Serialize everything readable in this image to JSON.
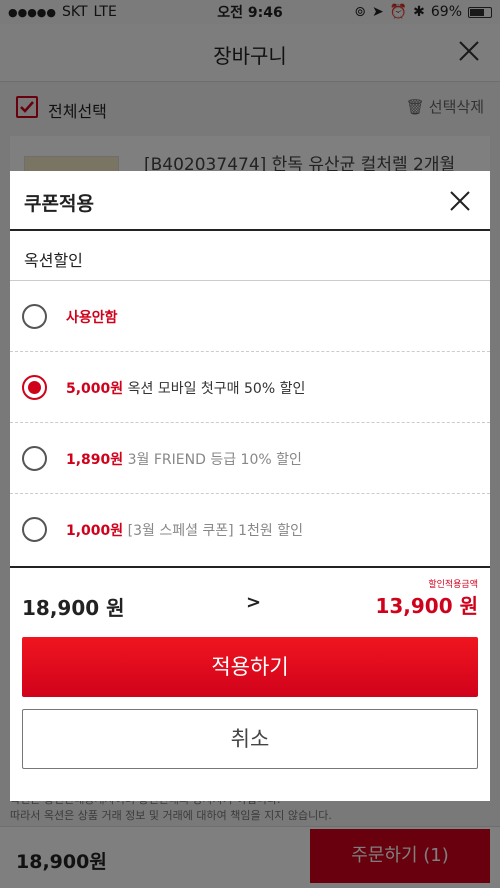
{
  "status_bar": {
    "carrier": "SKT",
    "network": "LTE",
    "time": "오전 9:46",
    "battery": "69%"
  },
  "page": {
    "title": "장바구니",
    "select_all_label": "전체선택",
    "delete_label": "선택삭제",
    "product_title": "[B402037474] 한독 유산균 컬처렐 2개월",
    "notice_lines": [
      "옥션은 통신판매중개자이며 통신판매의 당사자가 아닙니다.",
      "따라서 옥션은 상품 거래 정보 및 거래에 대하여 책임을 지지 않습니다."
    ],
    "total_price": "18,900원",
    "order_button": "주문하기 (1)"
  },
  "modal": {
    "title": "쿠폰적용",
    "section_title": "옥션할인",
    "options": [
      {
        "price": "사용안함",
        "desc": "",
        "selected": false,
        "muted": false
      },
      {
        "price": "5,000원",
        "desc": "옥션 모바일 첫구매 50% 할인",
        "selected": true,
        "muted": false
      },
      {
        "price": "1,890원",
        "desc": "3월 FRIEND 등급 10% 할인",
        "selected": false,
        "muted": true
      },
      {
        "price": "1,000원",
        "desc": "[3월 스페셜 쿠폰] 1천원 할인",
        "selected": false,
        "muted": true
      }
    ],
    "original_price": "18,900 원",
    "arrow": ">",
    "discount_label": "할인적용금액",
    "discounted_price": "13,900 원",
    "apply_button": "적용하기",
    "cancel_button": "취소"
  },
  "colors": {
    "accent": "#d0021b",
    "overlay": "rgba(0,0,0,0.5)"
  }
}
